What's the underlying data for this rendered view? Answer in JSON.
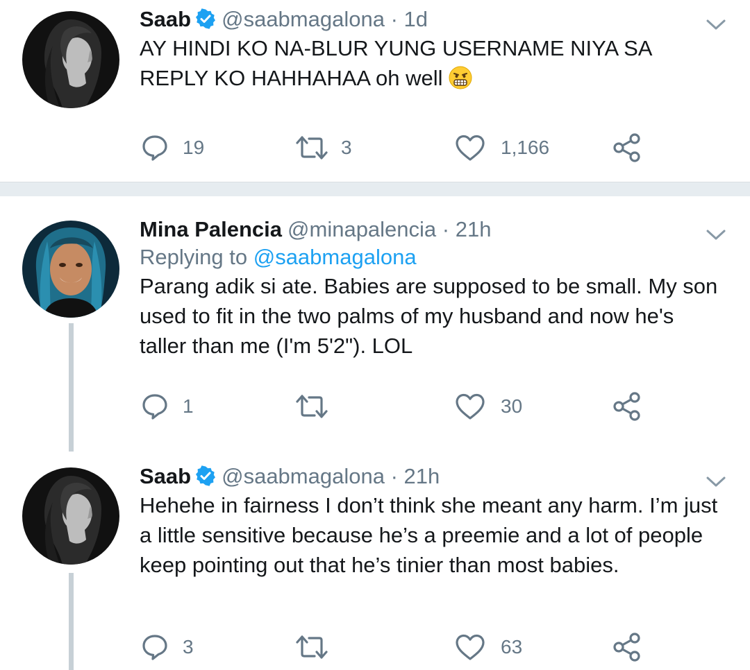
{
  "tweets": [
    {
      "name": "Saab",
      "verified": true,
      "handle": "@saabmagalona",
      "separator": "·",
      "time": "1d",
      "text": "AY HINDI KO NA-BLUR YUNG USERNAME NIYA SA REPLY KO HAHHAHAA oh well",
      "emoji": "grimacing-face-icon",
      "replies": "19",
      "retweets": "3",
      "likes": "1,166"
    },
    {
      "name": "Mina Palencia",
      "verified": false,
      "handle": "@minapalencia",
      "separator": "·",
      "time": "21h",
      "replying_prefix": "Replying to",
      "replying_to": "@saabmagalona",
      "text": "Parang adik si ate. Babies are supposed to be small. My son used to fit in the two palms of my husband and now he's taller than me (I'm 5'2\"). LOL",
      "replies": "1",
      "retweets": "",
      "likes": "30"
    },
    {
      "name": "Saab",
      "verified": true,
      "handle": "@saabmagalona",
      "separator": "·",
      "time": "21h",
      "text": "Hehehe in fairness I don’t think she meant any harm. I’m just a little sensitive because he’s a preemie and a lot of people keep pointing out that he’s tinier than most babies.",
      "replies": "3",
      "retweets": "",
      "likes": "63"
    }
  ],
  "icons": {
    "reply": "reply-icon",
    "retweet": "retweet-icon",
    "like": "heart-icon",
    "share": "share-icon",
    "more": "chevron-down-icon",
    "verified": "verified-badge-icon"
  },
  "colors": {
    "text": "#14171a",
    "secondary": "#657786",
    "link": "#1da1f2",
    "verified": "#1da1f2",
    "divider": "#e6ecf0",
    "thread_line": "#c7d0d6"
  }
}
